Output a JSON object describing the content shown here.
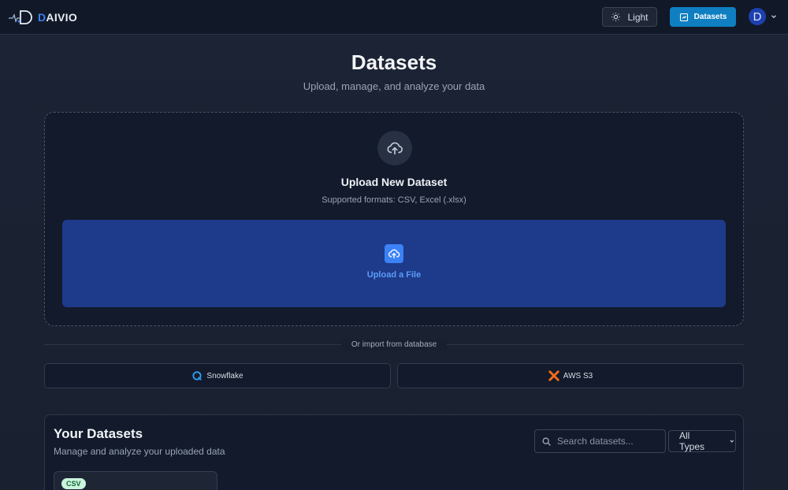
{
  "app": {
    "logo_letter": "D",
    "logo_rest": "AIVIO",
    "accent": "#3b82f6"
  },
  "header": {
    "theme_button": "Light",
    "datasets_button": "Datasets",
    "avatar_initial": "D"
  },
  "page": {
    "title": "Datasets",
    "subtitle": "Upload, manage, and analyze your data"
  },
  "upload": {
    "title": "Upload New Dataset",
    "formats": "Supported formats: CSV, Excel (.xlsx)",
    "dropzone_label": "Upload a File"
  },
  "import": {
    "divider_label": "Or import from database",
    "snowflake": "Snowflake",
    "s3": "AWS S3"
  },
  "your_datasets": {
    "title": "Your Datasets",
    "subtitle": "Manage and analyze your uploaded data",
    "search_placeholder": "Search datasets...",
    "type_filter": "All Types",
    "items": [
      {
        "badge": "CSV"
      }
    ]
  }
}
